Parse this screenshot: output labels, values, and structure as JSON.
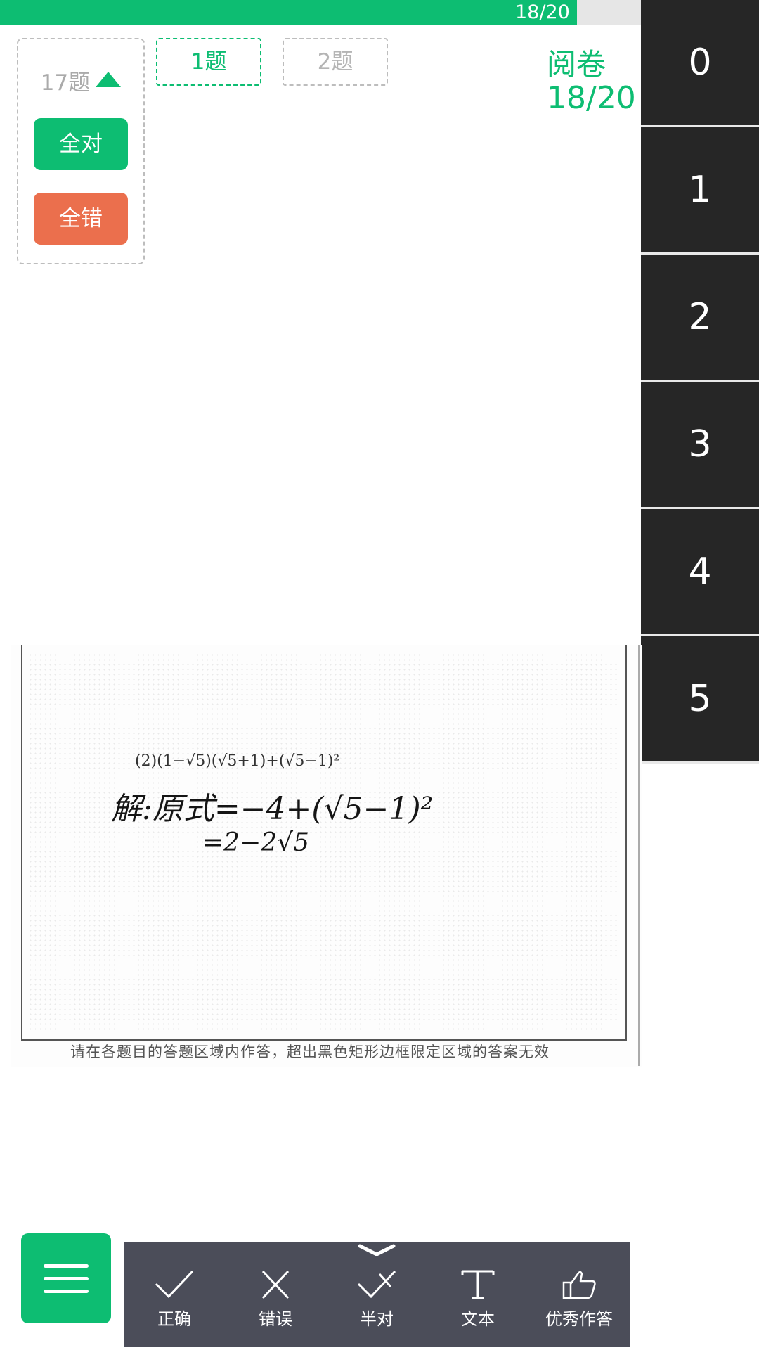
{
  "progress": {
    "text": "18/20",
    "fraction": 0.9
  },
  "question_group": {
    "title": "17题",
    "all_right_label": "全对",
    "all_wrong_label": "全错"
  },
  "question_tabs": [
    {
      "label": "1题",
      "active": true
    },
    {
      "label": "2题",
      "active": false
    }
  ],
  "review": {
    "label": "阅卷",
    "count": "18/20"
  },
  "scores": [
    "0",
    "1",
    "2",
    "3",
    "4",
    "5"
  ],
  "answer_scan": {
    "problem": "(2)(1−√5)(√5+1)+(√5−1)²",
    "line1": "解:原式=−4+(√5−1)²",
    "line2": "=2−2√5",
    "footer": "请在各题目的答题区域内作答，超出黑色矩形边框限定区域的答案无效"
  },
  "toolbar": {
    "tools": [
      {
        "label": "正确",
        "icon": "check-icon"
      },
      {
        "label": "错误",
        "icon": "cross-icon"
      },
      {
        "label": "半对",
        "icon": "half-check-icon"
      },
      {
        "label": "文本",
        "icon": "text-icon"
      },
      {
        "label": "优秀作答",
        "icon": "thumbs-up-icon"
      }
    ]
  },
  "colors": {
    "accent": "#0dbd72",
    "danger": "#eb6f4d",
    "score_bg": "#262626",
    "toolbar_bg": "#4b4d59"
  }
}
